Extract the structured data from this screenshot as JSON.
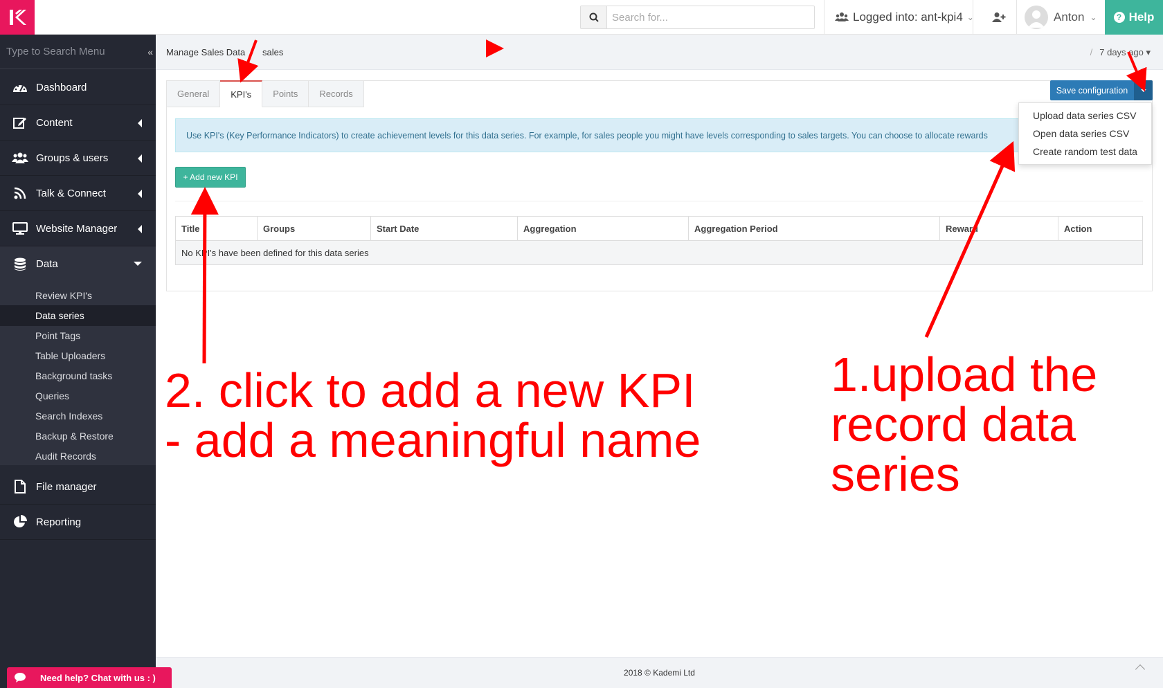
{
  "topbar": {
    "search_placeholder": "Search for...",
    "logged_label": "Logged into: ant-kpi4",
    "user_name": "Anton",
    "help_label": "Help"
  },
  "sidebar": {
    "search_placeholder": "Type to Search Menu",
    "items": [
      {
        "label": "Dashboard",
        "icon": "dashboard-icon"
      },
      {
        "label": "Content",
        "icon": "edit-icon"
      },
      {
        "label": "Groups & users",
        "icon": "users-icon"
      },
      {
        "label": "Talk & Connect",
        "icon": "rss-icon"
      },
      {
        "label": "Website Manager",
        "icon": "monitor-icon"
      },
      {
        "label": "Data",
        "icon": "database-icon"
      },
      {
        "label": "File manager",
        "icon": "file-icon"
      },
      {
        "label": "Reporting",
        "icon": "pie-chart-icon"
      }
    ],
    "data_subitems": [
      "Review KPI's",
      "Data series",
      "Point Tags",
      "Table Uploaders",
      "Background tasks",
      "Queries",
      "Search Indexes",
      "Backup & Restore",
      "Audit Records"
    ],
    "active_subitem": "Data series"
  },
  "breadcrumb": {
    "parent": "Manage Sales Data",
    "current": "sales",
    "updated": "7 days ago"
  },
  "tabs": [
    "General",
    "KPI's",
    "Points",
    "Records"
  ],
  "active_tab": "KPI's",
  "info_text": "Use KPI's (Key Performance Indicators) to create achievement levels for this data series. For example, for sales people you might have levels corresponding to sales targets. You can choose to allocate rewards",
  "add_button": "+ Add new KPI",
  "table": {
    "columns": [
      "Title",
      "Groups",
      "Start Date",
      "Aggregation",
      "Aggregation Period",
      "Reward",
      "Action"
    ],
    "empty_message": "No KPI's have been defined for this data series"
  },
  "save_button": "Save configuration",
  "dropdown_items": [
    "Upload data series CSV",
    "Open data series CSV",
    "Create random test data"
  ],
  "footer": {
    "copyright": "2018 © Kademi Ltd"
  },
  "chat_label": "Need help? Chat with us : )",
  "annotations": {
    "step2_line1": "2. click to add a new KPI",
    "step2_line2": " - add a meaningful name",
    "step1_line1": "1.upload the",
    "step1_line2": "record data",
    "step1_line3": "series"
  },
  "colors": {
    "brand": "#e8175d",
    "sidebar": "#252833",
    "help": "#3eb59c",
    "primary": "#2d7bb6",
    "annotation": "#ff0000"
  }
}
